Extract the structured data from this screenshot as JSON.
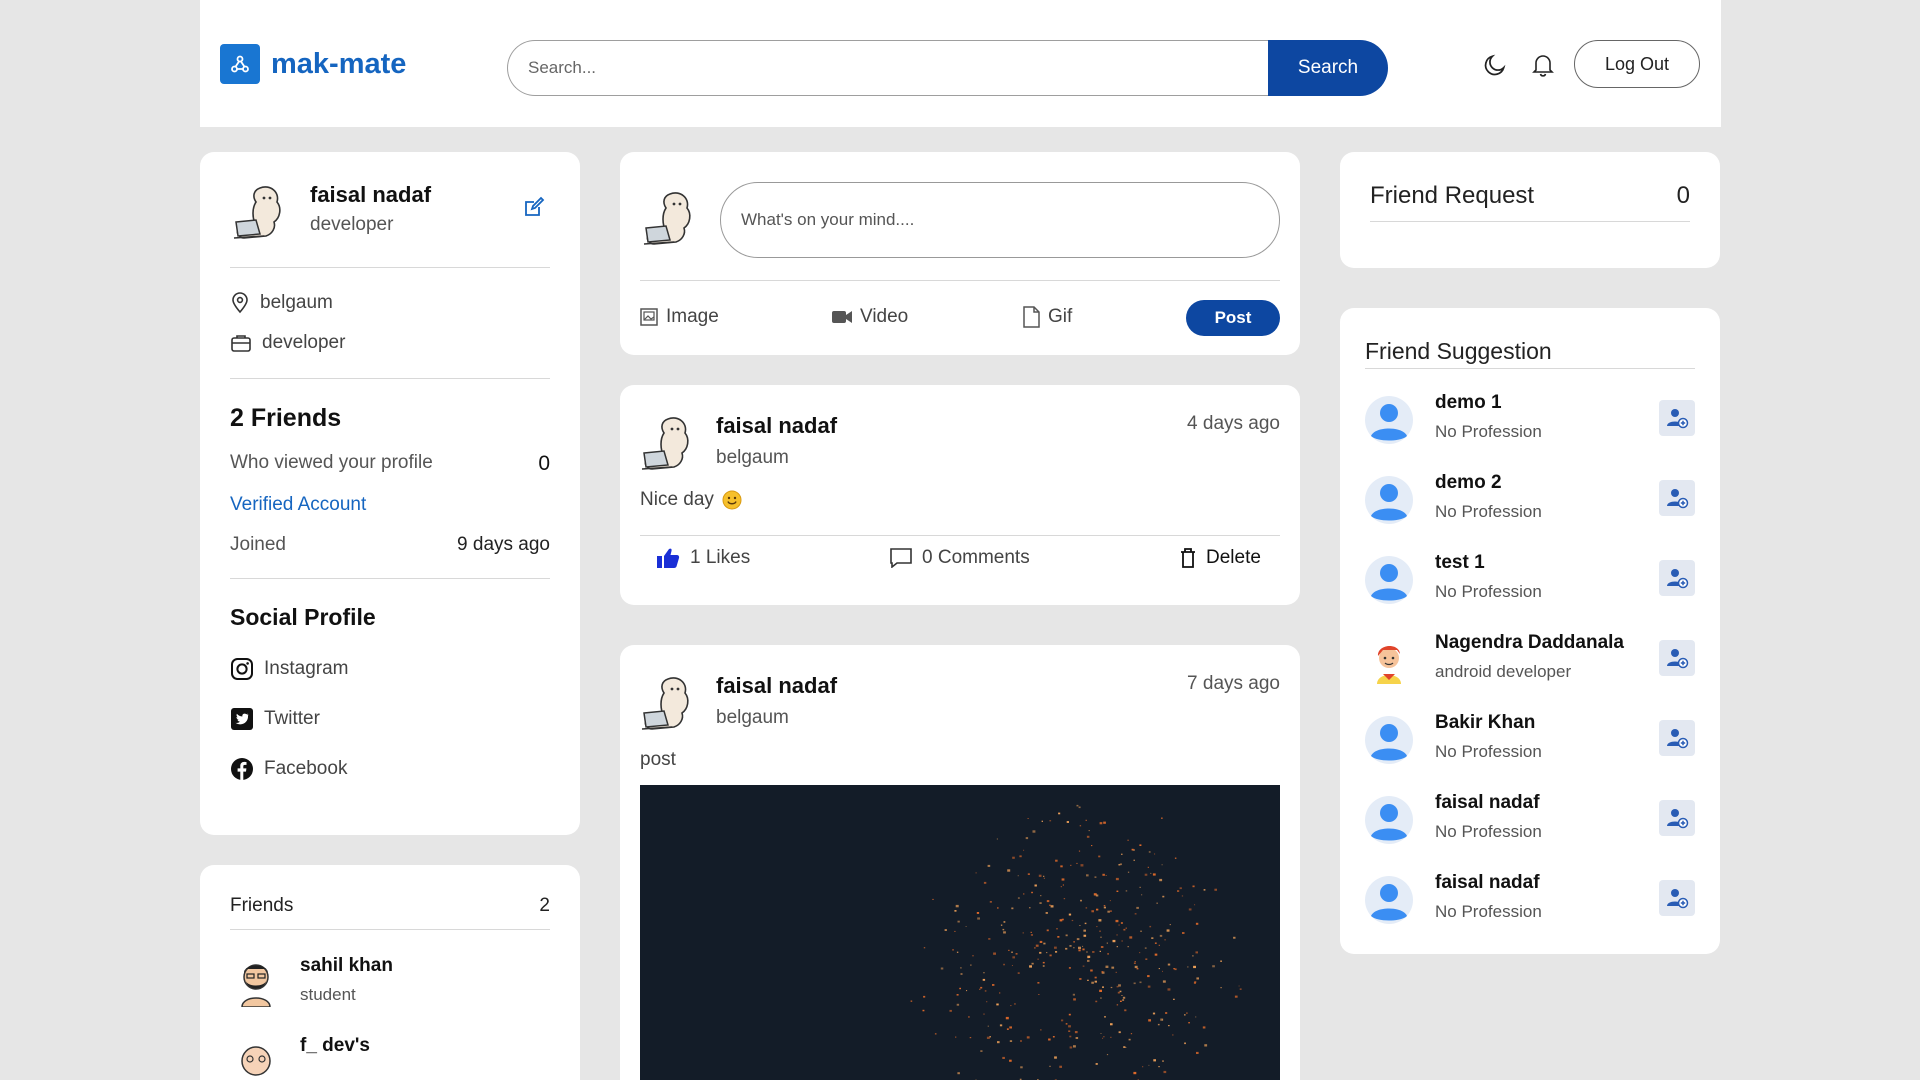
{
  "app": {
    "name": "mak-mate"
  },
  "search": {
    "placeholder": "Search...",
    "button": "Search"
  },
  "header": {
    "logout": "Log Out"
  },
  "profile": {
    "name": "faisal nadaf",
    "profession": "developer",
    "location": "belgaum",
    "job": "developer",
    "friends_label": "2 Friends",
    "viewed_label": "Who viewed your profile",
    "viewed_count": "0",
    "verified": "Verified Account",
    "joined_label": "Joined",
    "joined_value": "9 days ago",
    "social_title": "Social Profile",
    "social": [
      "Instagram",
      "Twitter",
      "Facebook"
    ]
  },
  "friends": {
    "title": "Friends",
    "count": "2",
    "items": [
      {
        "name": "sahil khan",
        "profession": "student"
      },
      {
        "name": "f_ dev's",
        "profession": ""
      }
    ]
  },
  "composer": {
    "placeholder": "What's on your mind....",
    "image": "Image",
    "video": "Video",
    "gif": "Gif",
    "post": "Post"
  },
  "posts": [
    {
      "name": "faisal nadaf",
      "location": "belgaum",
      "time": "4 days ago",
      "text": "Nice day",
      "likes": "1 Likes",
      "comments": "0 Comments",
      "delete": "Delete"
    },
    {
      "name": "faisal nadaf",
      "location": "belgaum",
      "time": "7 days ago",
      "text": "post"
    }
  ],
  "friend_request": {
    "title": "Friend Request",
    "count": "0"
  },
  "suggestions": {
    "title": "Friend Suggestion",
    "items": [
      {
        "name": "demo 1",
        "profession": "No Profession",
        "avatar": "default-user-icon"
      },
      {
        "name": "demo 2",
        "profession": "No Profession",
        "avatar": "default-user-icon"
      },
      {
        "name": "test 1",
        "profession": "No Profession",
        "avatar": "default-user-icon"
      },
      {
        "name": "Nagendra Daddanala",
        "profession": "android developer",
        "avatar": "cartoon-avatar"
      },
      {
        "name": "Bakir Khan",
        "profession": "No Profession",
        "avatar": "default-user-icon"
      },
      {
        "name": "faisal nadaf",
        "profession": "No Profession",
        "avatar": "default-user-icon"
      },
      {
        "name": "faisal nadaf",
        "profession": "No Profession",
        "avatar": "default-user-icon"
      }
    ]
  },
  "colors": {
    "primary": "#0d47a1",
    "brand": "#1976d2",
    "link": "#1565c0",
    "like": "#1a2fd6",
    "background": "#e6e6e6"
  }
}
